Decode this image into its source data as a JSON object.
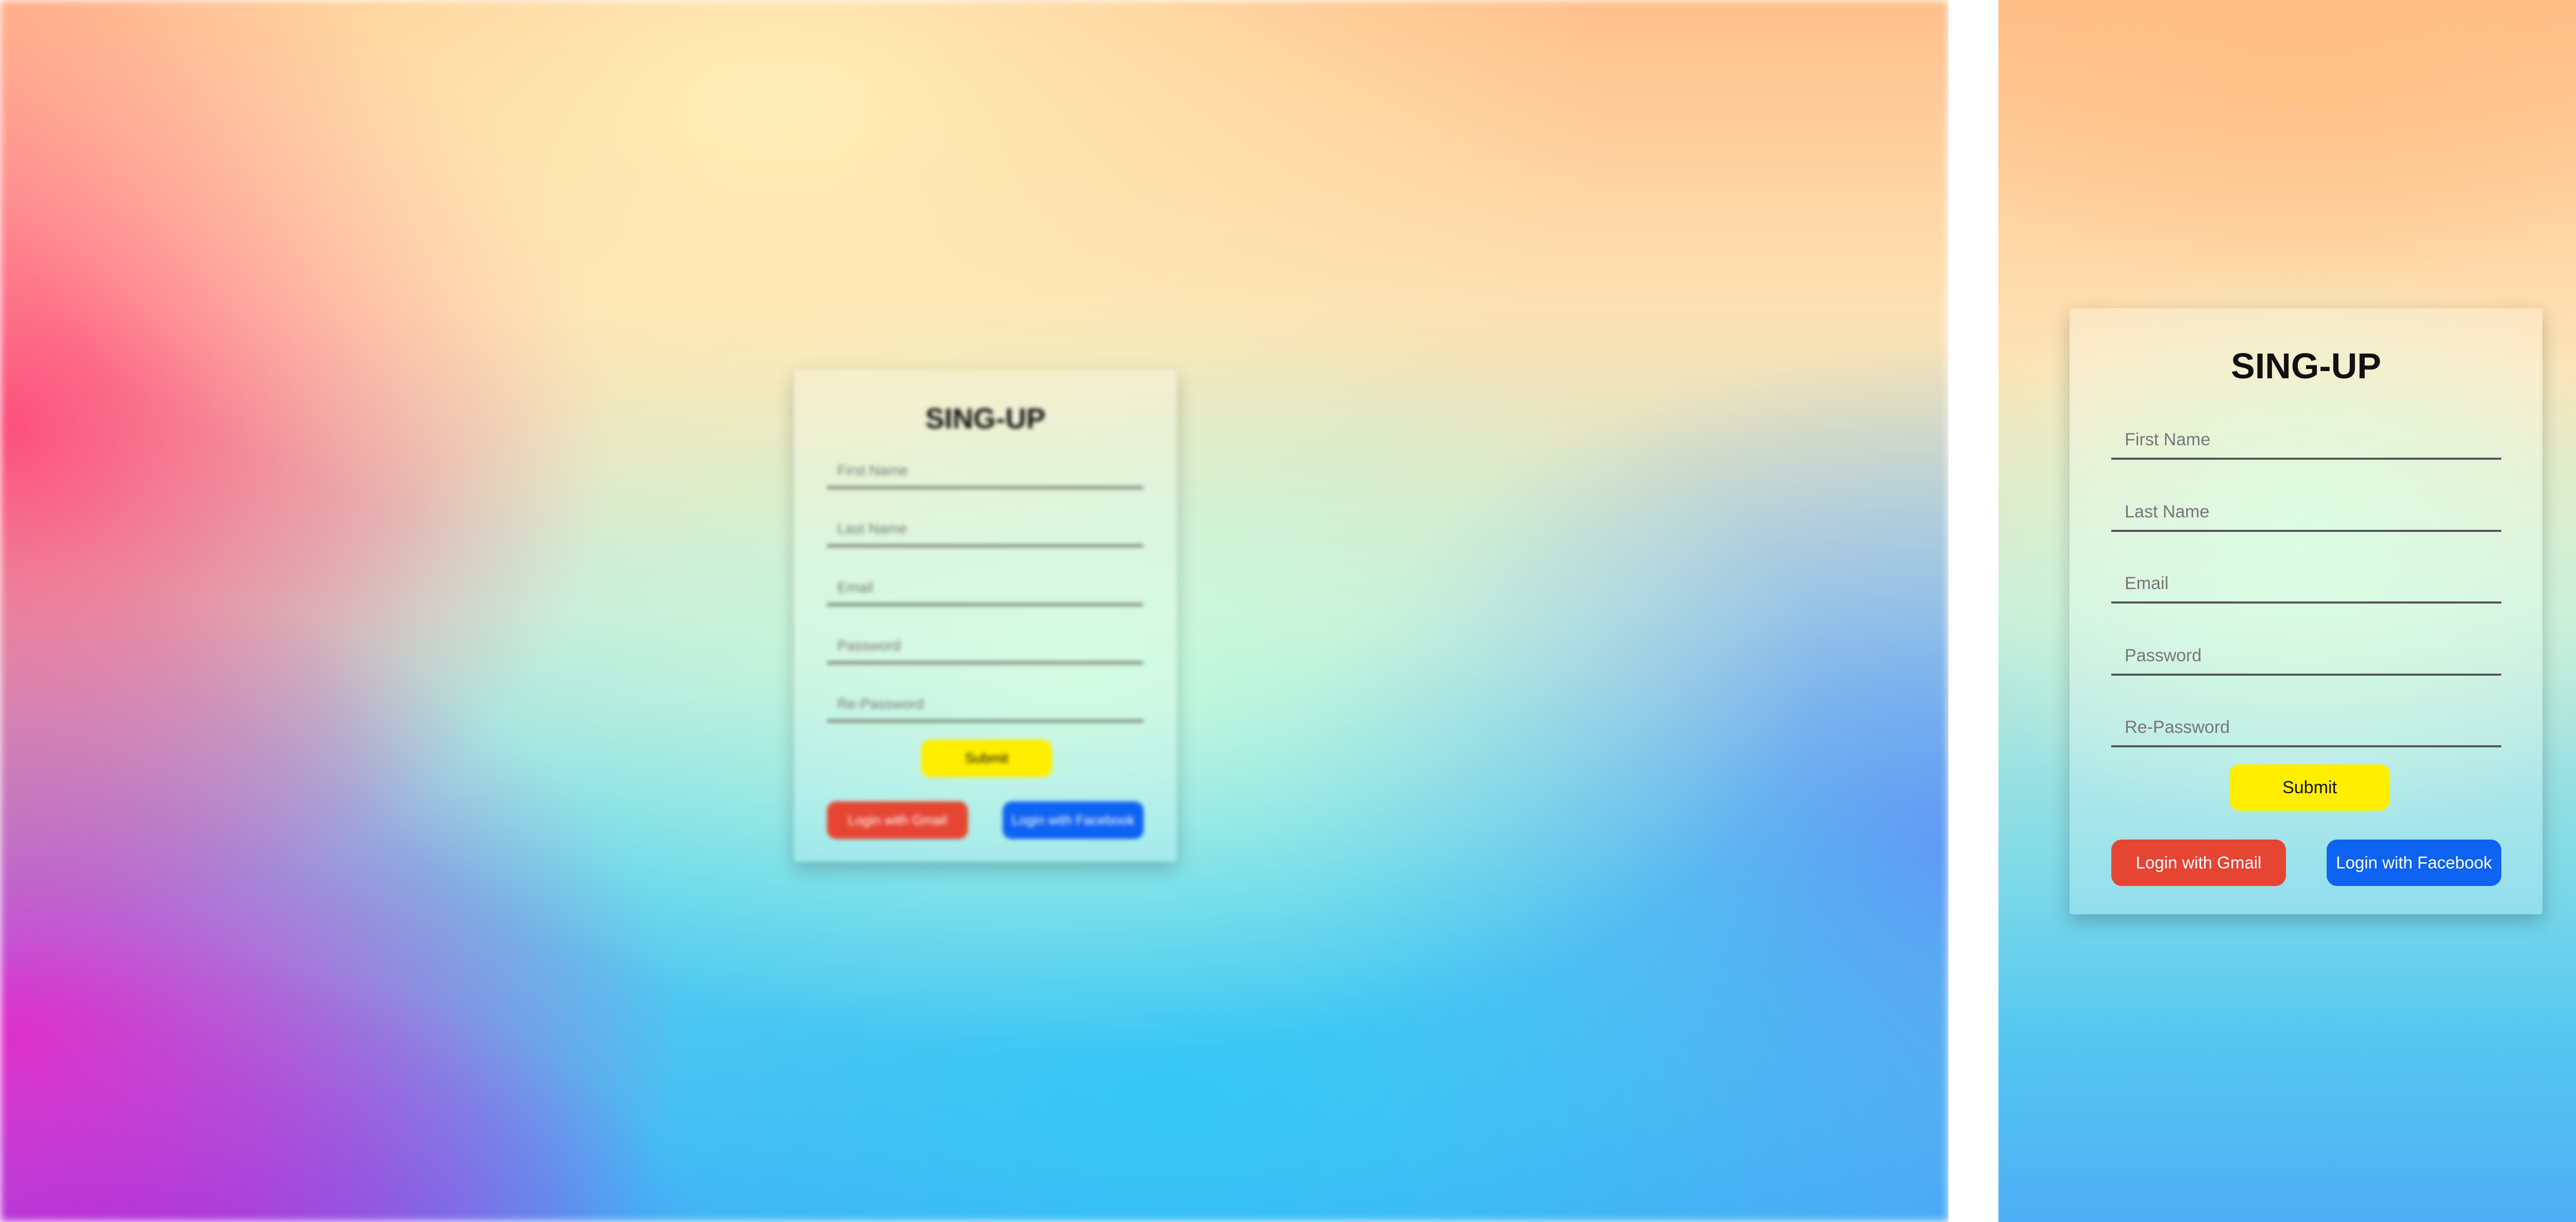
{
  "form": {
    "title": "SING-UP",
    "fields": [
      {
        "placeholder": "First Name",
        "value": ""
      },
      {
        "placeholder": "Last Name",
        "value": ""
      },
      {
        "placeholder": "Email",
        "value": ""
      },
      {
        "placeholder": "Password",
        "value": ""
      },
      {
        "placeholder": "Re-Password",
        "value": ""
      }
    ],
    "submit_label": "Submit",
    "gmail_label": "Login with Gmail",
    "facebook_label": "Login with Facebook"
  },
  "colors": {
    "submit": "#ffee00",
    "gmail": "#e64533",
    "facebook": "#0f63f2",
    "title": "#111111",
    "field_underline": "#555555"
  }
}
